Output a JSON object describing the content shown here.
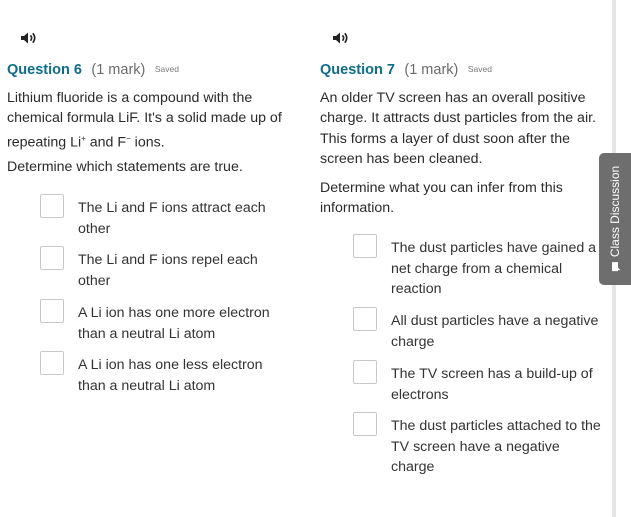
{
  "q6": {
    "title": "Question 6",
    "mark": "(1 mark)",
    "saved": "Saved",
    "stem_part1": "Lithium fluoride is a compound with the chemical formula LiF. It's a solid made up of repeating Li",
    "stem_sup1": "+",
    "stem_part2": " and F",
    "stem_sup2": "−",
    "stem_part3": " ions.",
    "instruction": "Determine which statements are true.",
    "options": [
      "The Li and F ions attract each other",
      "The Li and F ions repel each other",
      "A Li ion has one more electron than a neutral Li atom",
      "A Li ion has one less electron than a neutral Li atom"
    ]
  },
  "q7": {
    "title": "Question 7",
    "mark": "(1 mark)",
    "saved": "Saved",
    "stem": "An older TV screen has an overall positive charge. It attracts dust particles from the air. This forms a layer of dust soon after the screen has been cleaned.",
    "instruction": "Determine what you can infer from this information.",
    "options": [
      "The dust particles have gained a net charge from a chemical reaction",
      "All dust particles have a negative charge",
      "The TV screen has a build-up of electrons",
      "The dust particles attached to the TV screen have a negative charge"
    ]
  },
  "sidebar": {
    "class_discussion_label": "Class Discussion"
  },
  "icons": {
    "speaker": "speaker-icon",
    "chat": "chat-bubble-icon"
  }
}
